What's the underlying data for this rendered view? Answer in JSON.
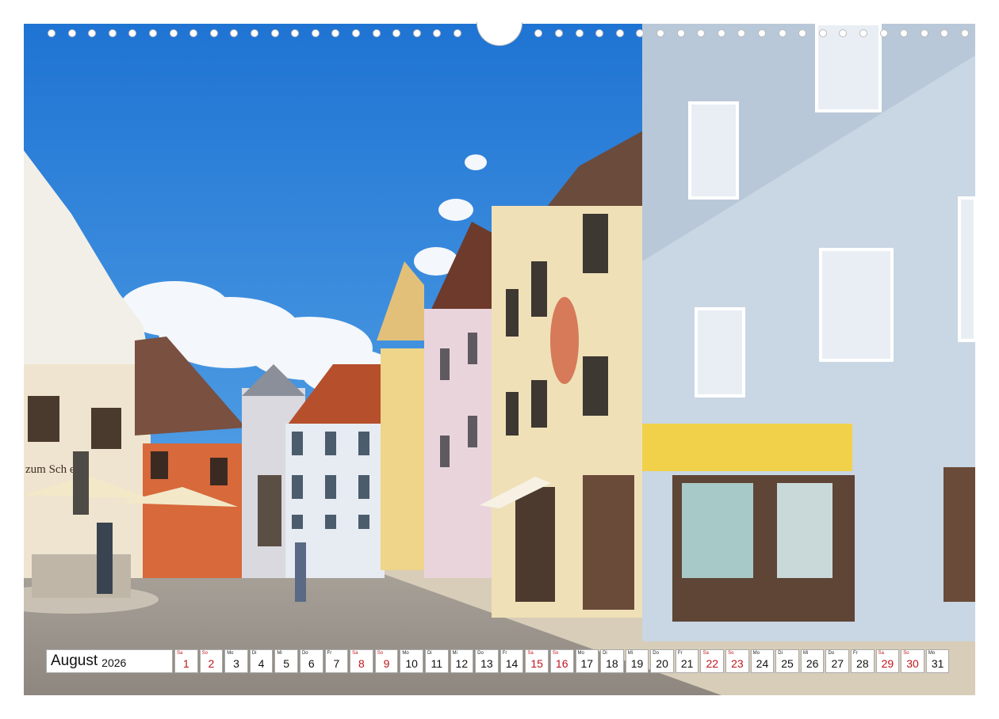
{
  "calendar": {
    "month": "August",
    "year": "2026",
    "days": [
      {
        "wd": "Sa",
        "n": "1",
        "weekend": true
      },
      {
        "wd": "So",
        "n": "2",
        "weekend": true
      },
      {
        "wd": "Mo",
        "n": "3",
        "weekend": false
      },
      {
        "wd": "Di",
        "n": "4",
        "weekend": false
      },
      {
        "wd": "Mi",
        "n": "5",
        "weekend": false
      },
      {
        "wd": "Do",
        "n": "6",
        "weekend": false
      },
      {
        "wd": "Fr",
        "n": "7",
        "weekend": false
      },
      {
        "wd": "Sa",
        "n": "8",
        "weekend": true
      },
      {
        "wd": "So",
        "n": "9",
        "weekend": true
      },
      {
        "wd": "Mo",
        "n": "10",
        "weekend": false
      },
      {
        "wd": "Di",
        "n": "11",
        "weekend": false
      },
      {
        "wd": "Mi",
        "n": "12",
        "weekend": false
      },
      {
        "wd": "Do",
        "n": "13",
        "weekend": false
      },
      {
        "wd": "Fr",
        "n": "14",
        "weekend": false
      },
      {
        "wd": "Sa",
        "n": "15",
        "weekend": true
      },
      {
        "wd": "So",
        "n": "16",
        "weekend": true
      },
      {
        "wd": "Mo",
        "n": "17",
        "weekend": false
      },
      {
        "wd": "Di",
        "n": "18",
        "weekend": false
      },
      {
        "wd": "Mi",
        "n": "19",
        "weekend": false
      },
      {
        "wd": "Do",
        "n": "20",
        "weekend": false
      },
      {
        "wd": "Fr",
        "n": "21",
        "weekend": false
      },
      {
        "wd": "Sa",
        "n": "22",
        "weekend": true
      },
      {
        "wd": "So",
        "n": "23",
        "weekend": true
      },
      {
        "wd": "Mo",
        "n": "24",
        "weekend": false
      },
      {
        "wd": "Di",
        "n": "25",
        "weekend": false
      },
      {
        "wd": "Mi",
        "n": "26",
        "weekend": false
      },
      {
        "wd": "Do",
        "n": "27",
        "weekend": false
      },
      {
        "wd": "Fr",
        "n": "28",
        "weekend": false
      },
      {
        "wd": "Sa",
        "n": "29",
        "weekend": true
      },
      {
        "wd": "So",
        "n": "30",
        "weekend": true
      },
      {
        "wd": "Mo",
        "n": "31",
        "weekend": false
      }
    ]
  },
  "photo": {
    "shop_sign": "zum Sch    ein"
  },
  "colors": {
    "sky": "#2a7fd8",
    "weekend": "#c0141c"
  }
}
